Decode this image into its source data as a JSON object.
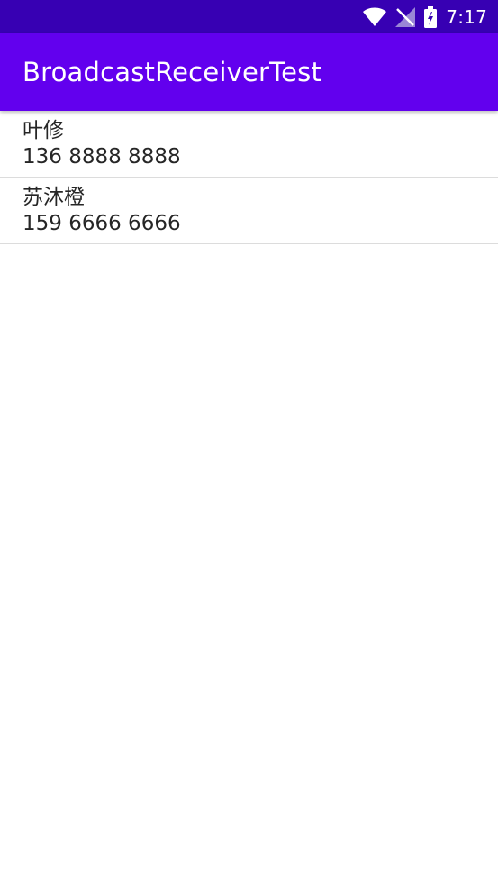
{
  "status_bar": {
    "time": "7:17",
    "icons": [
      "wifi-icon",
      "no-signal-icon",
      "battery-charging-icon"
    ]
  },
  "app_bar": {
    "title": "BroadcastReceiverTest"
  },
  "contacts": [
    {
      "name": "叶修",
      "phone": "136 8888 8888"
    },
    {
      "name": "苏沐橙",
      "phone": "159 6666 6666"
    }
  ],
  "colors": {
    "status_bar": "#3700b3",
    "app_bar": "#6200ee",
    "text": "#262626",
    "divider": "#dcdcdc"
  }
}
